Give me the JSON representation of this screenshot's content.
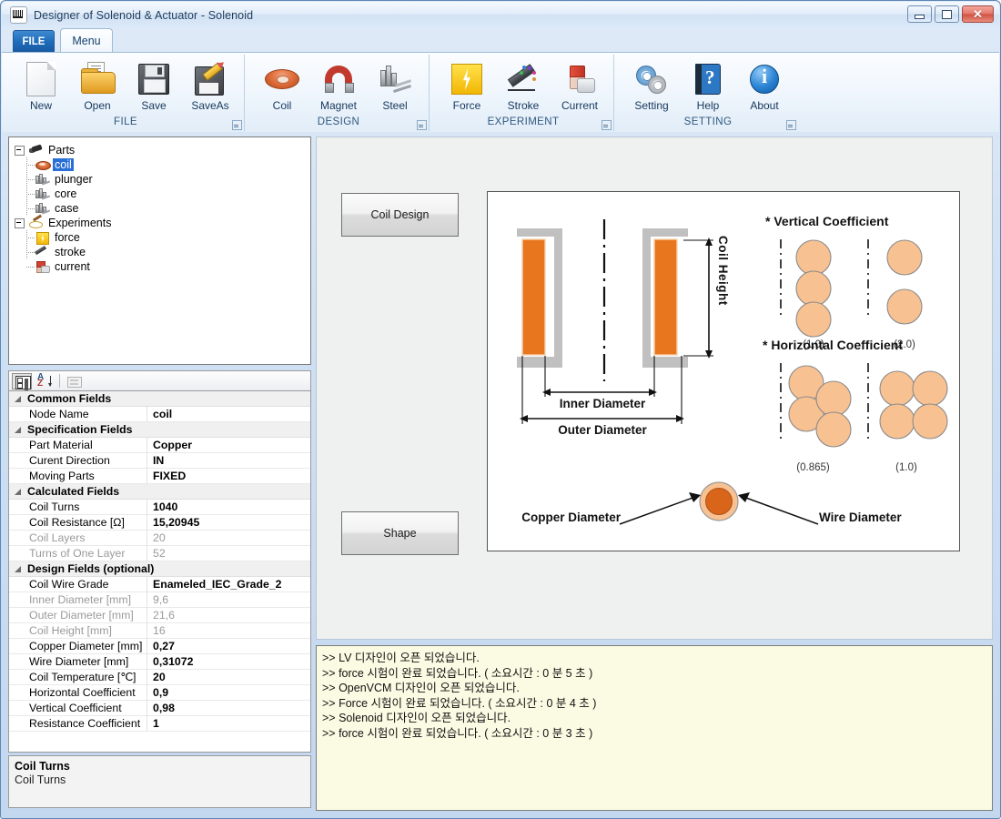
{
  "window": {
    "title": "Designer of Solenoid & Actuator - Solenoid",
    "icon": "app-coil-icon",
    "minimize_label": "",
    "maximize_label": "",
    "close_label": "✕"
  },
  "ribbon": {
    "tabs": [
      {
        "label": "FILE",
        "id": "file"
      },
      {
        "label": "Menu",
        "id": "menu"
      }
    ],
    "groups": [
      {
        "title": "FILE",
        "items": [
          {
            "label": "New",
            "icon": "new-document-icon"
          },
          {
            "label": "Open",
            "icon": "open-folder-icon"
          },
          {
            "label": "Save",
            "icon": "floppy-disk-icon"
          },
          {
            "label": "SaveAs",
            "icon": "floppy-disk-pencil-icon"
          }
        ]
      },
      {
        "title": "DESIGN",
        "items": [
          {
            "label": "Coil",
            "icon": "torus-coil-icon"
          },
          {
            "label": "Magnet",
            "icon": "horseshoe-magnet-icon"
          },
          {
            "label": "Steel",
            "icon": "steel-bars-icon"
          }
        ]
      },
      {
        "title": "EXPERIMENT",
        "items": [
          {
            "label": "Force",
            "icon": "lightning-bolt-icon"
          },
          {
            "label": "Stroke",
            "icon": "pencil-stroke-icon"
          },
          {
            "label": "Current",
            "icon": "paint-can-icon"
          }
        ]
      },
      {
        "title": "SETTING",
        "items": [
          {
            "label": "Setting",
            "icon": "gears-icon"
          },
          {
            "label": "Help",
            "icon": "help-book-icon"
          },
          {
            "label": "About",
            "icon": "info-circle-icon"
          }
        ]
      }
    ]
  },
  "tree": {
    "nodes": [
      {
        "label": "Parts",
        "level": 0,
        "icon": "parts-icon",
        "expanded": true,
        "selected": false
      },
      {
        "label": "coil",
        "level": 1,
        "icon": "coil-icon",
        "selected": true
      },
      {
        "label": "plunger",
        "level": 1,
        "icon": "steel-icon",
        "selected": false
      },
      {
        "label": "core",
        "level": 1,
        "icon": "steel-icon",
        "selected": false
      },
      {
        "label": "case",
        "level": 1,
        "icon": "steel-icon",
        "selected": false
      },
      {
        "label": "Experiments",
        "level": 0,
        "icon": "experiments-icon",
        "expanded": true,
        "selected": false
      },
      {
        "label": "force",
        "level": 1,
        "icon": "force-icon",
        "selected": false
      },
      {
        "label": "stroke",
        "level": 1,
        "icon": "stroke-icon",
        "selected": false
      },
      {
        "label": "current",
        "level": 1,
        "icon": "current-icon",
        "selected": false
      }
    ]
  },
  "property_grid": {
    "toolbar": [
      {
        "name": "categorized-view-button",
        "icon": "categorized-icon",
        "active": true
      },
      {
        "name": "alphabetical-sort-button",
        "icon": "sort-az-icon",
        "active": false
      },
      {
        "name": "property-pages-button",
        "icon": "property-pages-icon",
        "active": false,
        "disabled": true
      }
    ],
    "rows": [
      {
        "type": "category",
        "name": "Common Fields"
      },
      {
        "type": "item",
        "name": "Node Name",
        "value": "coil",
        "dim": false
      },
      {
        "type": "category",
        "name": "Specification Fields"
      },
      {
        "type": "item",
        "name": "Part Material",
        "value": "Copper",
        "dim": false
      },
      {
        "type": "item",
        "name": "Curent Direction",
        "value": "IN",
        "dim": false
      },
      {
        "type": "item",
        "name": "Moving Parts",
        "value": "FIXED",
        "dim": false
      },
      {
        "type": "category",
        "name": "Calculated Fields"
      },
      {
        "type": "item",
        "name": "Coil Turns",
        "value": "1040",
        "dim": false
      },
      {
        "type": "item",
        "name": "Coil Resistance [Ω]",
        "value": "15,20945",
        "dim": false
      },
      {
        "type": "item",
        "name": "Coil Layers",
        "value": "20",
        "dim": true
      },
      {
        "type": "item",
        "name": "Turns of One Layer",
        "value": "52",
        "dim": true
      },
      {
        "type": "category",
        "name": "Design Fields (optional)"
      },
      {
        "type": "item",
        "name": "Coil Wire Grade",
        "value": "Enameled_IEC_Grade_2",
        "dim": false
      },
      {
        "type": "item",
        "name": "Inner Diameter [mm]",
        "value": "9,6",
        "dim": true
      },
      {
        "type": "item",
        "name": "Outer Diameter [mm]",
        "value": "21,6",
        "dim": true
      },
      {
        "type": "item",
        "name": "Coil Height [mm]",
        "value": "16",
        "dim": true
      },
      {
        "type": "item",
        "name": "Copper Diameter [mm]",
        "value": "0,27",
        "dim": false
      },
      {
        "type": "item",
        "name": "Wire Diameter [mm]",
        "value": "0,31072",
        "dim": false
      },
      {
        "type": "item",
        "name": "Coil Temperature [℃]",
        "value": "20",
        "dim": false
      },
      {
        "type": "item",
        "name": "Horizontal Coefficient",
        "value": "0,9",
        "dim": false
      },
      {
        "type": "item",
        "name": "Vertical Coefficient",
        "value": "0,98",
        "dim": false
      },
      {
        "type": "item",
        "name": "Resistance Coefficient",
        "value": "1",
        "dim": false
      }
    ],
    "description": {
      "title": "Coil Turns",
      "text": "Coil Turns"
    }
  },
  "main": {
    "buttons": [
      {
        "id": "coil-design",
        "label": "Coil Design"
      },
      {
        "id": "shape",
        "label": "Shape"
      }
    ],
    "diagram": {
      "labels": {
        "coil_height": "Coil Height",
        "inner_diameter": "Inner Diameter",
        "outer_diameter": "Outer Diameter",
        "copper_diameter": "Copper Diameter",
        "wire_diameter": "Wire Diameter"
      },
      "vertical_coefficient": {
        "title": "* Vertical Coefficient",
        "cases": [
          {
            "value": "(1.0)",
            "circles": 3,
            "packing": "touching"
          },
          {
            "value": "(2.0)",
            "circles": 2,
            "packing": "spaced"
          }
        ]
      },
      "horizontal_coefficient": {
        "title": "* Horizontal Coefficient",
        "cases": [
          {
            "value": "(0.865)",
            "circles": 4,
            "packing": "staggered"
          },
          {
            "value": "(1.0)",
            "circles": 4,
            "packing": "square"
          }
        ]
      },
      "colors": {
        "coil_fill": "#e8761e",
        "bobbin": "#c0c0c0",
        "circle_fill": "#f8c191",
        "wire_core": "#d9651a"
      }
    }
  },
  "log": {
    "lines": [
      ">> LV 디자인이 오픈 되었습니다.",
      ">> force 시험이 완료 되었습니다. ( 소요시간 : 0 분 5 초 )",
      ">> OpenVCM 디자인이 오픈 되었습니다.",
      ">> Force 시험이 완료 되었습니다. ( 소요시간 : 0 분 4 초 )",
      ">> Solenoid 디자인이 오픈 되었습니다.",
      ">> force 시험이 완료 되었습니다. ( 소요시간 : 0 분 3 초 )"
    ]
  }
}
